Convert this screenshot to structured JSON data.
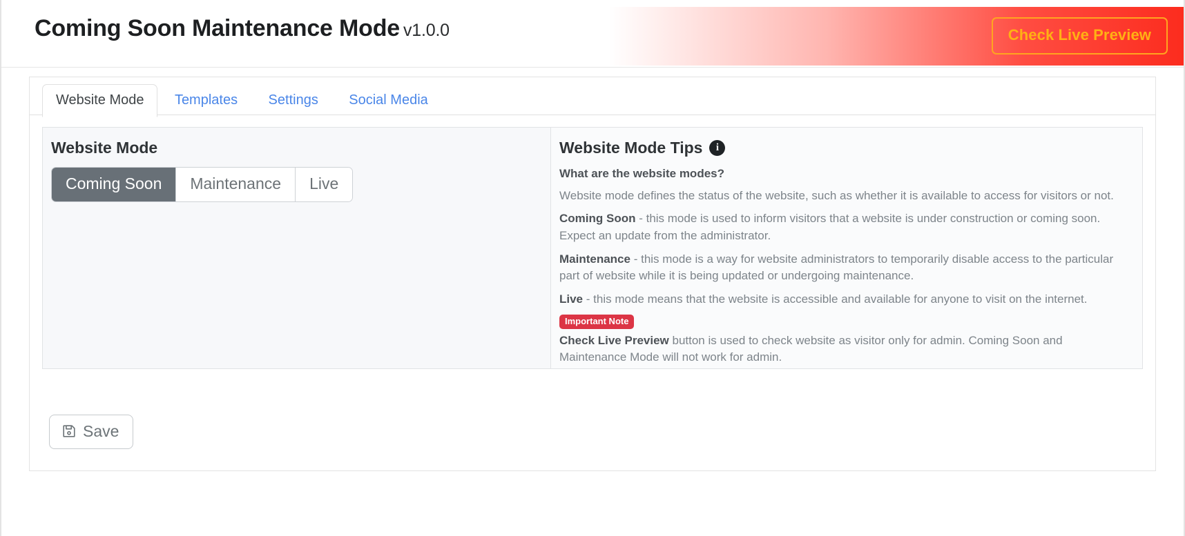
{
  "header": {
    "title": "Coming Soon Maintenance Mode",
    "version": "v1.0.0",
    "live_preview_label": "Check Live Preview",
    "accent_red": "#fc2c1e",
    "accent_orange": "#ffb114"
  },
  "tabs": [
    {
      "label": "Website Mode",
      "active": true
    },
    {
      "label": "Templates",
      "active": false
    },
    {
      "label": "Settings",
      "active": false
    },
    {
      "label": "Social Media",
      "active": false
    }
  ],
  "website_mode": {
    "heading": "Website Mode",
    "selected": "Coming Soon",
    "options": [
      {
        "label": "Coming Soon"
      },
      {
        "label": "Maintenance"
      },
      {
        "label": "Live"
      }
    ]
  },
  "tips": {
    "heading": "Website Mode Tips",
    "info_icon": "info-icon",
    "question": "What are the website modes?",
    "intro": "Website mode defines the status of the website, such as whether it is available to access for visitors or not.",
    "coming_soon_term": "Coming Soon",
    "coming_soon_desc": " - this mode is used to inform visitors that a website is under construction or coming soon. Expect an update from the administrator.",
    "maintenance_term": "Maintenance",
    "maintenance_desc": " - this mode is a way for website administrators to temporarily disable access to the particular part of website while it is being updated or undergoing maintenance.",
    "live_term": "Live",
    "live_desc": " - this mode means that the website is accessible and available for anyone to visit on the internet.",
    "note_badge": "Important Note",
    "note_term": "Check Live Preview",
    "note_desc": " button is used to check website as visitor only for admin. Coming Soon and Maintenance Mode will not work for admin.",
    "badge_color": "#dc3545"
  },
  "footer": {
    "save_label": "Save",
    "save_icon": "floppy-disk-icon"
  }
}
